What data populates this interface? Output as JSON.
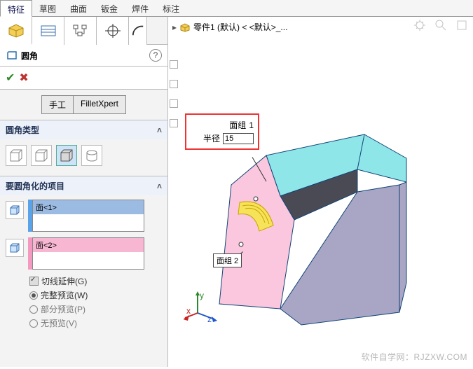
{
  "ribbon": {
    "tabs": [
      "特征",
      "草图",
      "曲面",
      "钣金",
      "焊件",
      "标注"
    ],
    "active": 0
  },
  "panel": {
    "title": "圆角",
    "modes": {
      "manual": "手工",
      "xpert": "FilletXpert"
    },
    "sections": {
      "type": "圆角类型",
      "items": "要圆角化的项目"
    },
    "faces": {
      "f1": "面<1>",
      "f2": "面<2>"
    },
    "options": {
      "tangent": "切线延伸(G)",
      "full": "完整预览(W)",
      "partial": "部分预览(P)",
      "none": "无预览(V)"
    }
  },
  "breadcrumb": "零件1 (默认) < <默认>_...",
  "callout": {
    "group_label": "面组",
    "group_value": "1",
    "radius_label": "半径",
    "radius_value": "15"
  },
  "tag2": "面组 2",
  "watermark": "软件自学网：RJZXW.COM"
}
